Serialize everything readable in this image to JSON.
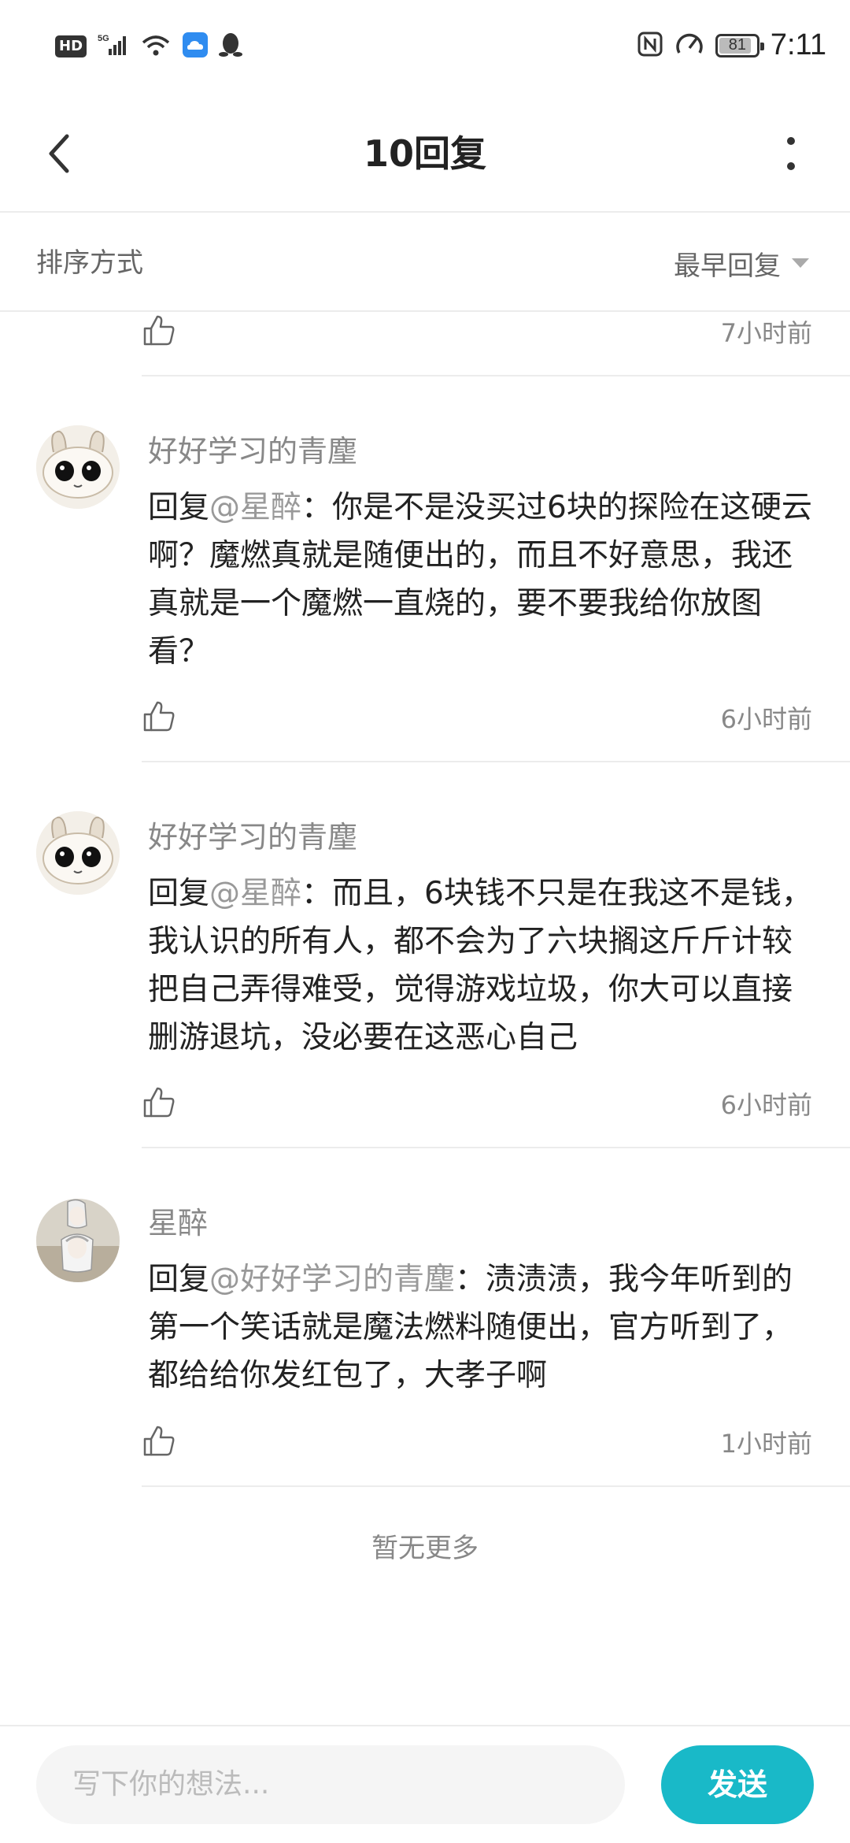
{
  "status_bar": {
    "hd": "HD",
    "network": "5G",
    "battery": "81",
    "time": "7:11"
  },
  "header": {
    "title": "10回复"
  },
  "sort": {
    "label": "排序方式",
    "value": "最早回复"
  },
  "top_partial": {
    "time": "7小时前"
  },
  "comments": [
    {
      "username": "好好学习的青麈",
      "reply_prefix": "回复",
      "mention": "@星醉",
      "text": "：你是不是没买过6块的探险在这硬云啊？魔燃真就是随便出的，而且不好意思，我还真就是一个魔燃一直烧的，要不要我给你放图看？",
      "time": "6小时前"
    },
    {
      "username": "好好学习的青麈",
      "reply_prefix": "回复",
      "mention": "@星醉",
      "text": "：而且，6块钱不只是在我这不是钱，我认识的所有人，都不会为了六块搁这斤斤计较把自己弄得难受，觉得游戏垃圾，你大可以直接删游退坑，没必要在这恶心自己",
      "time": "6小时前"
    },
    {
      "username": "星醉",
      "reply_prefix": "回复",
      "mention": "@好好学习的青麈",
      "text": "：渍渍渍，我今年听到的第一个笑话就是魔法燃料随便出，官方听到了，都给给你发红包了，大孝子啊",
      "time": "1小时前"
    }
  ],
  "footer": {
    "no_more": "暂无更多"
  },
  "input": {
    "placeholder": "写下你的想法...",
    "send_label": "发送"
  },
  "colors": {
    "accent": "#19b9c8",
    "muted_text": "#888888",
    "divider": "#ececec"
  }
}
